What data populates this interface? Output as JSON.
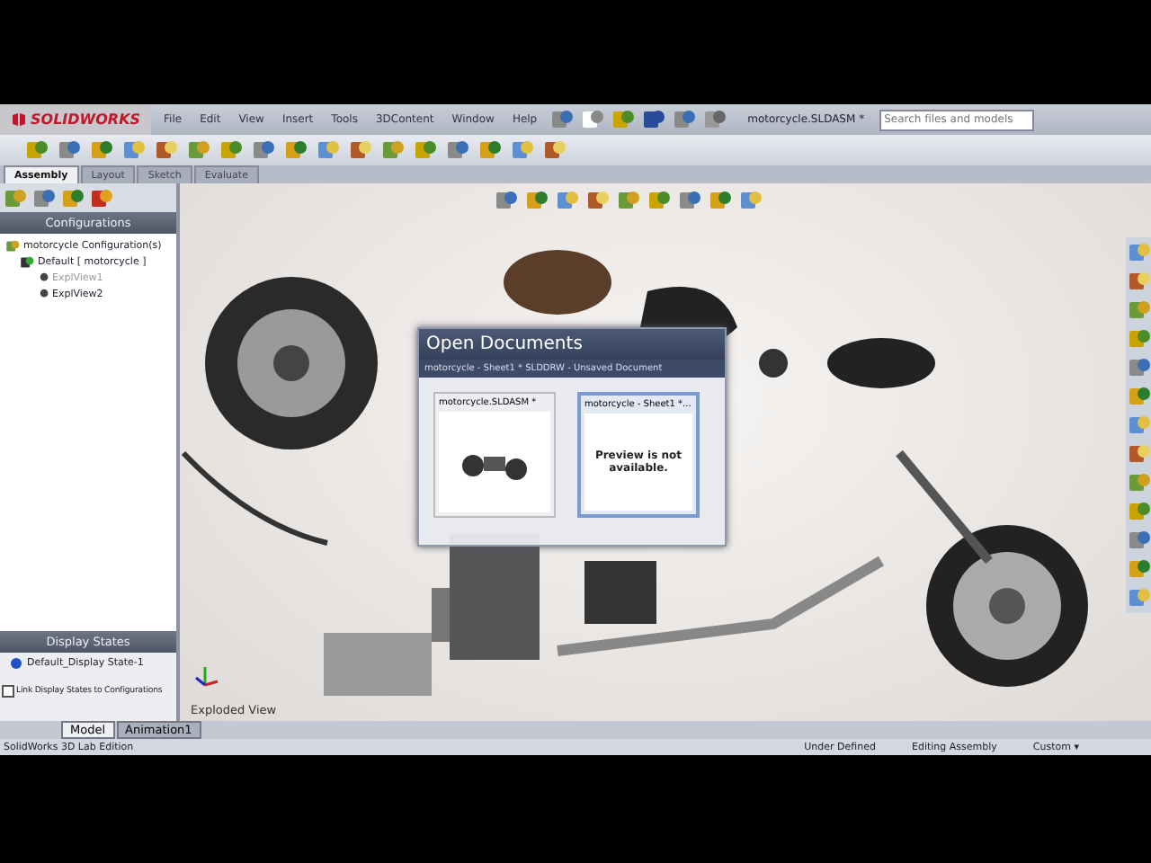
{
  "app": {
    "logo": "SOLIDWORKS",
    "menu": [
      "File",
      "Edit",
      "View",
      "Insert",
      "Tools",
      "3DContent",
      "Window",
      "Help"
    ],
    "document_title": "motorcycle.SLDASM *",
    "search": {
      "placeholder": "Search files and models"
    }
  },
  "command_tabs": [
    {
      "label": "Assembly",
      "selected": true
    },
    {
      "label": "Layout",
      "selected": false
    },
    {
      "label": "Sketch",
      "selected": false
    },
    {
      "label": "Evaluate",
      "selected": false
    }
  ],
  "configurations": {
    "title": "Configurations",
    "tree": [
      {
        "label": "motorcycle Configuration(s)",
        "greyed": false,
        "children": [
          {
            "label": "Default [ motorcycle ]",
            "greyed": false,
            "children": [
              {
                "label": "ExplView1",
                "greyed": true
              },
              {
                "label": "ExplView2",
                "greyed": false
              }
            ]
          }
        ]
      }
    ]
  },
  "display_states": {
    "title": "Display States",
    "items": [
      "Default_Display State-1"
    ],
    "link": {
      "label": "Link Display States to Configurations",
      "checked": false
    }
  },
  "viewport": {
    "caption": "Exploded View"
  },
  "open_documents": {
    "title": "Open Documents",
    "subtitle": "motorcycle - Sheet1 * SLDDRW - Unsaved Document",
    "documents": [
      {
        "name": "motorcycle.SLDASM *",
        "kind": "assembly",
        "selected": false
      },
      {
        "name": "motorcycle - Sheet1 *...",
        "kind": "drawing",
        "preview_text": "Preview is not available.",
        "selected": true
      }
    ]
  },
  "bottom_tabs": [
    {
      "label": "Model",
      "selected": true
    },
    {
      "label": "Animation1",
      "selected": false
    }
  ],
  "status_bar": {
    "product": "SolidWorks 3D Lab Edition",
    "items": [
      "Under Defined",
      "Editing Assembly",
      "Custom ▾"
    ]
  }
}
